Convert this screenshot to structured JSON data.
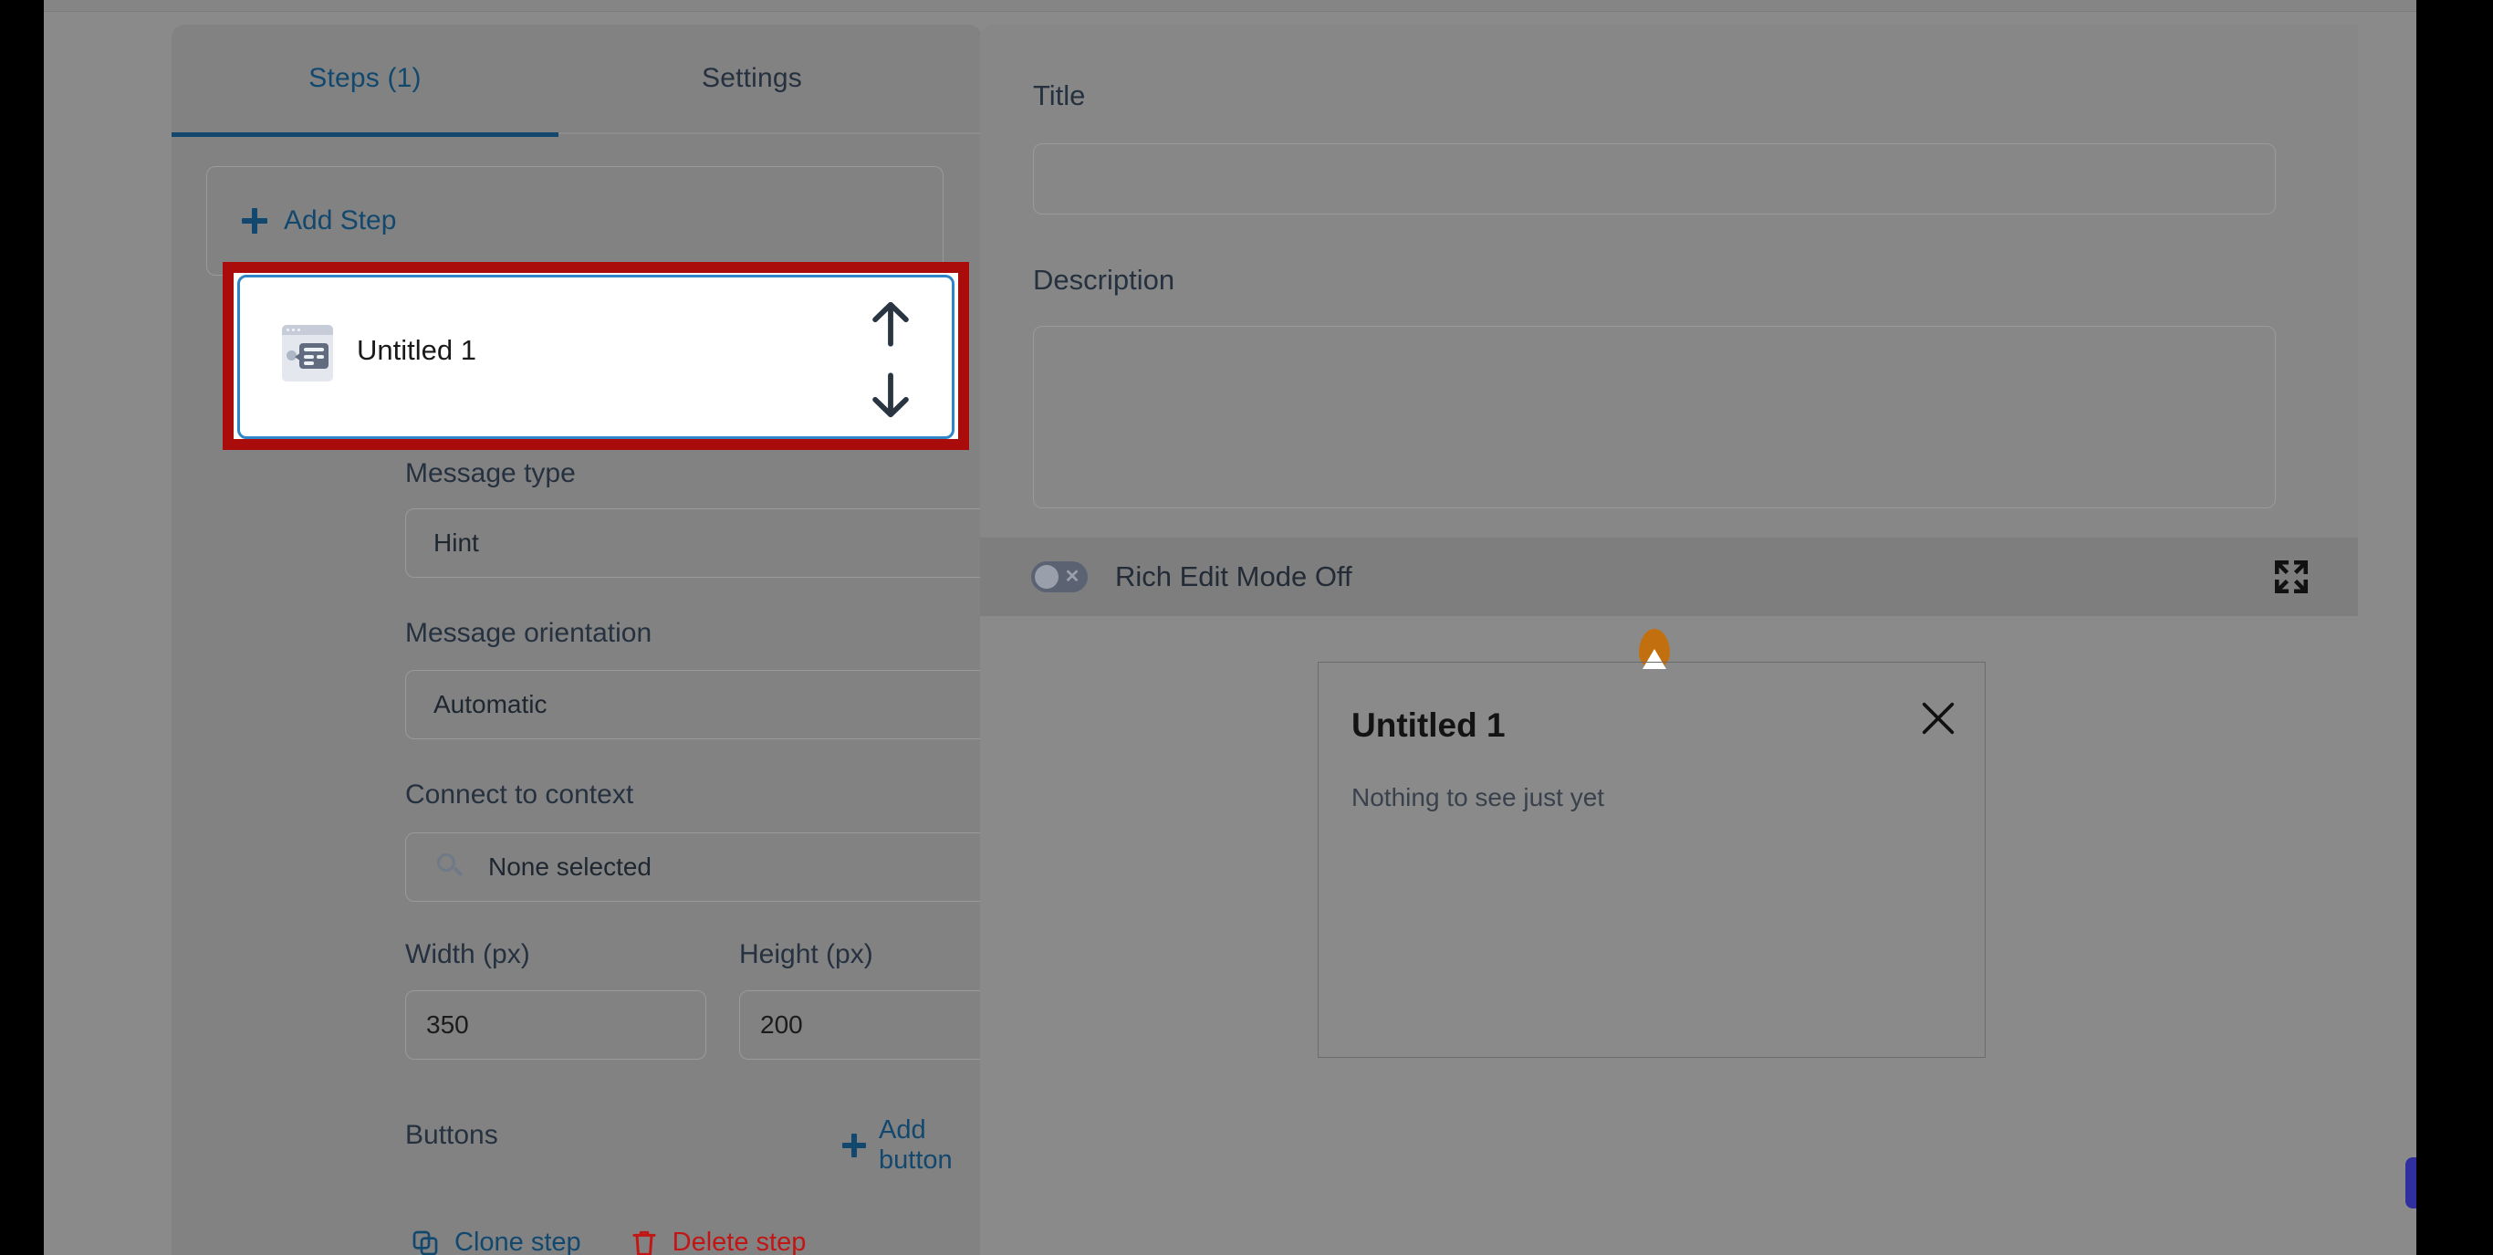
{
  "left_panel": {
    "tabs": [
      {
        "label": "Steps (1)",
        "active": true
      },
      {
        "label": "Settings",
        "active": false
      }
    ],
    "add_step_label": "Add Step",
    "step": {
      "name": "Untitled 1",
      "icon": "tooltip-step-icon",
      "move_up_icon": "arrow-up-icon",
      "move_down_icon": "arrow-down-icon"
    },
    "fields": {
      "message_type": {
        "label": "Message type",
        "value": "Hint"
      },
      "message_orientation": {
        "label": "Message orientation",
        "value": "Automatic"
      },
      "connect_to_context": {
        "label": "Connect to context",
        "value": "None selected",
        "icon": "search-icon"
      },
      "width": {
        "label": "Width (px)",
        "value": "350"
      },
      "height": {
        "label": "Height (px)",
        "value": "200"
      }
    },
    "buttons_section": {
      "label": "Buttons",
      "add_button_label": "Add button"
    },
    "actions": {
      "clone_label": "Clone step",
      "delete_label": "Delete step"
    }
  },
  "right_panel": {
    "title": {
      "label": "Title",
      "value": "",
      "placeholder": ""
    },
    "description": {
      "label": "Description",
      "value": "",
      "placeholder": ""
    },
    "rich_edit": {
      "label": "Rich Edit Mode Off",
      "enabled": false,
      "expand_icon": "expand-fullscreen-icon"
    },
    "preview": {
      "popup_title": "Untitled 1",
      "popup_body": "Nothing to see just yet",
      "close_icon": "close-icon",
      "anchor_icon": "anchor-pin-marker"
    }
  },
  "colors": {
    "accent_blue": "#12486e",
    "link_blue": "#12486e",
    "danger_red": "#c21616",
    "annotation_red": "#aa0c0c",
    "card_border_blue": "#2e86c8",
    "anchor_orange": "#c2700f"
  }
}
